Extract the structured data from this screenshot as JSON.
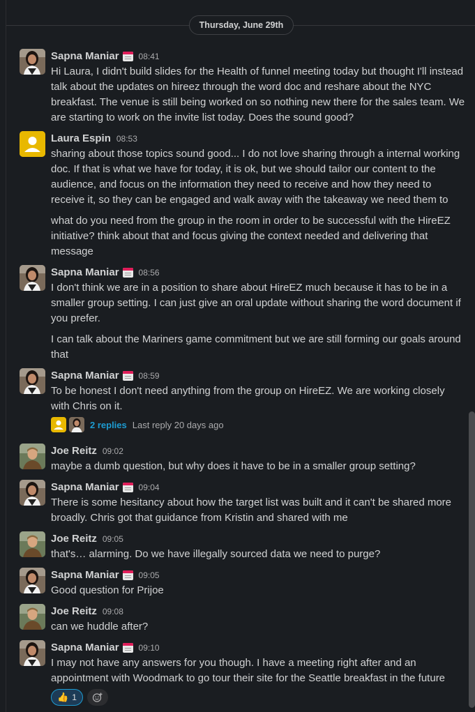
{
  "channel": {
    "date_divider": "Thursday, June 29th"
  },
  "messages": [
    {
      "author": "Sapna Maniar",
      "time": "08:41",
      "paragraphs": [
        "Hi Laura, I didn't build slides for the Health of funnel meeting today but thought I'll instead talk about the updates on hireez through the word doc and reshare about the NYC breakfast. The venue is still being worked on so nothing new there for the sales team. We are starting to work on the invite list today. Does the sound good?"
      ]
    },
    {
      "author": "Laura Espin",
      "time": "08:53",
      "paragraphs": [
        "sharing about those topics sound good... I do not love sharing through a internal working doc. If that is what we have for today, it is ok, but we should tailor our content to the audience, and focus on the information they need to receive and how they need to receive it, so they can be engaged and walk away with the takeaway we need them to",
        "what do you need from the group in the room in order to be successful with the HireEZ initiative? think about that and focus giving the context needed and delivering that message"
      ]
    },
    {
      "author": "Sapna Maniar",
      "time": "08:56",
      "paragraphs": [
        "I don't think we are in a position to share about HireEZ much because it has to be in a smaller group setting. I can just give an oral update without sharing the word document if you prefer.",
        "I can talk about the Mariners game commitment but we are still forming our goals around that"
      ]
    },
    {
      "author": "Sapna Maniar",
      "time": "08:59",
      "paragraphs": [
        "To be honest I don't need anything from the group on HireEZ. We are working closely with Chris on it."
      ],
      "thread": {
        "count": "2 replies",
        "last": "Last reply 20 days ago"
      }
    },
    {
      "author": "Joe Reitz",
      "time": "09:02",
      "paragraphs": [
        "maybe a dumb question, but why does it have to be in a smaller group setting?"
      ]
    },
    {
      "author": "Sapna Maniar",
      "time": "09:04",
      "paragraphs": [
        "There is some hesitancy about how the target list was built and it can't be shared more broadly. Chris got that guidance from Kristin and shared with me"
      ]
    },
    {
      "author": "Joe Reitz",
      "time": "09:05",
      "paragraphs": [
        "that's… alarming. Do we have illegally sourced data we need to purge?"
      ]
    },
    {
      "author": "Sapna Maniar",
      "time": "09:05",
      "paragraphs": [
        "Good question for Prijoe"
      ]
    },
    {
      "author": "Joe Reitz",
      "time": "09:08",
      "paragraphs": [
        "can we huddle after?"
      ]
    },
    {
      "author": "Sapna Maniar",
      "time": "09:10",
      "paragraphs": [
        "I may not have any answers for you though. I have a meeting right after and an appointment with Woodmark to go tour their site for the Seattle breakfast in the future"
      ],
      "reaction": {
        "emoji": "👍",
        "count": "1"
      }
    }
  ]
}
